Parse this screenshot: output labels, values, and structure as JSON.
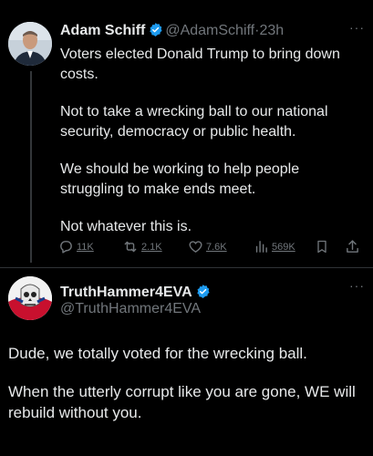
{
  "tweet": {
    "author_name": "Adam Schiff",
    "author_handle": "@AdamSchiff",
    "separator": "·",
    "time": "23h",
    "paragraphs": [
      "Voters elected Donald Trump to bring down costs.",
      "Not to take a wrecking ball to our national security, democracy or public health.",
      "We should be working to help people struggling to make ends meet.",
      "Not whatever this is."
    ],
    "actions": {
      "replies": "11K",
      "reposts": "2.1K",
      "likes": "7.6K",
      "views": "569K"
    }
  },
  "reply": {
    "author_name": "TruthHammer4EVA",
    "author_handle": "@TruthHammer4EVA",
    "paragraphs": [
      "Dude, we totally voted for the wrecking ball.",
      "When the utterly corrupt like you are gone, WE will rebuild without you."
    ]
  },
  "icons": {
    "verified": "verified-badge-icon",
    "more": "more-icon",
    "reply": "reply-icon",
    "repost": "repost-icon",
    "like": "heart-icon",
    "views": "views-icon",
    "bookmark": "bookmark-icon",
    "share": "share-icon"
  },
  "colors": {
    "background": "#000000",
    "text": "#e7e9ea",
    "muted": "#71767b",
    "verified": "#1d9bf0"
  }
}
